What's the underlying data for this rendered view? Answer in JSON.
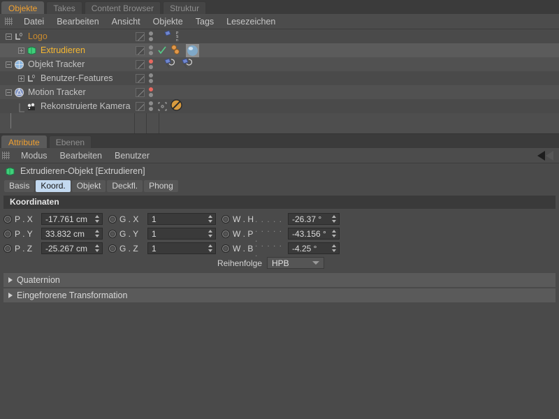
{
  "object_manager": {
    "tabs": [
      {
        "label": "Objekte",
        "active": true
      },
      {
        "label": "Takes",
        "active": false
      },
      {
        "label": "Content Browser",
        "active": false
      },
      {
        "label": "Struktur",
        "active": false
      }
    ],
    "menu": [
      "Datei",
      "Bearbeiten",
      "Ansicht",
      "Objekte",
      "Tags",
      "Lesezeichen"
    ],
    "rows": [
      {
        "name": "Logo",
        "icon": "null-object-icon",
        "color": "dimorange",
        "depth": 0,
        "expander": "minus",
        "visibility": "grey",
        "tags": "pose-morph-tag"
      },
      {
        "name": "Extrudieren",
        "icon": "extrude-object-icon",
        "color": "orange",
        "depth": 1,
        "expander": "plus",
        "visibility": "check",
        "tags": "material-tag"
      },
      {
        "name": "Objekt Tracker",
        "icon": "object-tracker-icon",
        "color": "grey",
        "depth": 0,
        "expander": "minus",
        "visibility": "red",
        "tags": "constraint-tags"
      },
      {
        "name": "Benutzer-Features",
        "icon": "null-object-icon",
        "color": "grey",
        "depth": 1,
        "expander": "plus",
        "visibility": "grey",
        "tags": ""
      },
      {
        "name": "Motion Tracker",
        "icon": "motion-tracker-icon",
        "color": "grey",
        "depth": 0,
        "expander": "minus",
        "visibility": "red",
        "tags": ""
      },
      {
        "name": "Rekonstruierte Kamera",
        "icon": "reconstructed-camera-icon",
        "color": "grey",
        "depth": 1,
        "expander": "none",
        "visibility": "target",
        "tags": "protection-tag"
      }
    ]
  },
  "attribute_manager": {
    "tabs": [
      {
        "label": "Attribute",
        "active": true
      },
      {
        "label": "Ebenen",
        "active": false
      }
    ],
    "menu": [
      "Modus",
      "Bearbeiten",
      "Benutzer"
    ],
    "object_title": "Extrudieren-Objekt [Extrudieren]",
    "subtabs": [
      {
        "label": "Basis",
        "active": false
      },
      {
        "label": "Koord.",
        "active": true
      },
      {
        "label": "Objekt",
        "active": false
      },
      {
        "label": "Deckfl.",
        "active": false
      },
      {
        "label": "Phong",
        "active": false
      }
    ],
    "section_title": "Koordinaten",
    "coordinates": {
      "position": [
        {
          "label": "P . X",
          "value": "-17.761 cm"
        },
        {
          "label": "P . Y",
          "value": "33.832 cm"
        },
        {
          "label": "P . Z",
          "value": "-25.267 cm"
        }
      ],
      "size": [
        {
          "label": "G . X",
          "value": "1"
        },
        {
          "label": "G . Y",
          "value": "1"
        },
        {
          "label": "G . Z",
          "value": "1"
        }
      ],
      "rotation": [
        {
          "label": "W . H",
          "leader": ". . . . .",
          "value": "-26.37 °"
        },
        {
          "label": "W . P",
          "leader": ". . . . . .",
          "value": "-43.156 °"
        },
        {
          "label": "W . B",
          "leader": ". . . . . .",
          "value": "-4.25 °"
        }
      ],
      "order_label": "Reihenfolge",
      "order_value": "HPB"
    },
    "collapsed_sections": [
      {
        "label": "Quaternion"
      },
      {
        "label": "Eingefrorene Transformation"
      }
    ]
  },
  "colors": {
    "accent_orange": "#f0a030",
    "selected_object": "#f5b731",
    "unselected_parent": "#c98a2e",
    "active_subtab_bg": "#c3d9f0",
    "panel_bg": "#4a4a4a",
    "row_alt": "#515151",
    "visibility_red": "#e8685f",
    "check_green": "#55cc88"
  }
}
